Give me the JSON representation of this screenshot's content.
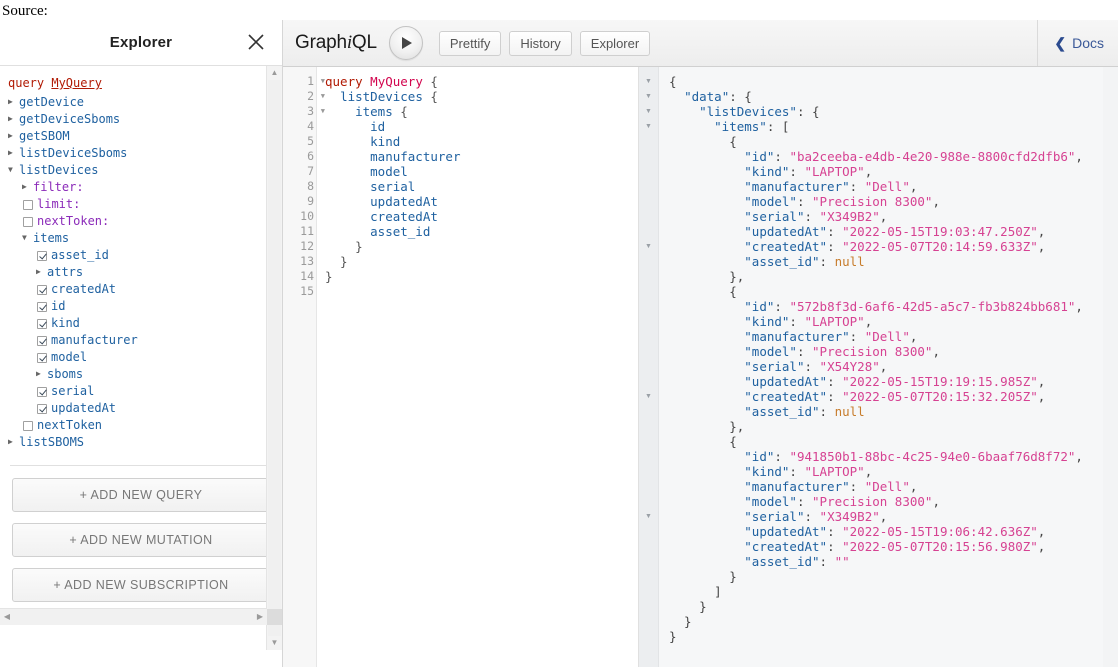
{
  "page": {
    "source_label": "Source:"
  },
  "explorer": {
    "title": "Explorer",
    "close_icon": "close-icon",
    "query_keyword": "query",
    "query_name": "MyQuery",
    "tree": [
      {
        "indent": 1,
        "control": "arrow-closed",
        "label": "getDevice",
        "style": "field"
      },
      {
        "indent": 1,
        "control": "arrow-closed",
        "label": "getDeviceSboms",
        "style": "field"
      },
      {
        "indent": 1,
        "control": "arrow-closed",
        "label": "getSBOM",
        "style": "field"
      },
      {
        "indent": 1,
        "control": "arrow-closed",
        "label": "listDeviceSboms",
        "style": "field"
      },
      {
        "indent": 1,
        "control": "arrow-open",
        "label": "listDevices",
        "style": "field"
      },
      {
        "indent": 2,
        "control": "arrow-closed",
        "label": "filter:",
        "style": "arg"
      },
      {
        "indent": 2,
        "control": "checkbox-off",
        "label": "limit:",
        "style": "arg"
      },
      {
        "indent": 2,
        "control": "checkbox-off",
        "label": "nextToken:",
        "style": "arg"
      },
      {
        "indent": 2,
        "control": "arrow-open",
        "label": "items",
        "style": "field"
      },
      {
        "indent": 3,
        "control": "checkbox-on",
        "label": "asset_id",
        "style": "field"
      },
      {
        "indent": 3,
        "control": "arrow-closed",
        "label": "attrs",
        "style": "field"
      },
      {
        "indent": 3,
        "control": "checkbox-on",
        "label": "createdAt",
        "style": "field"
      },
      {
        "indent": 3,
        "control": "checkbox-on",
        "label": "id",
        "style": "field"
      },
      {
        "indent": 3,
        "control": "checkbox-on",
        "label": "kind",
        "style": "field"
      },
      {
        "indent": 3,
        "control": "checkbox-on",
        "label": "manufacturer",
        "style": "field"
      },
      {
        "indent": 3,
        "control": "checkbox-on",
        "label": "model",
        "style": "field"
      },
      {
        "indent": 3,
        "control": "arrow-closed",
        "label": "sboms",
        "style": "field"
      },
      {
        "indent": 3,
        "control": "checkbox-on",
        "label": "serial",
        "style": "field"
      },
      {
        "indent": 3,
        "control": "checkbox-on",
        "label": "updatedAt",
        "style": "field"
      },
      {
        "indent": 2,
        "control": "checkbox-off",
        "label": "nextToken",
        "style": "field"
      },
      {
        "indent": 1,
        "control": "arrow-closed",
        "label": "listSBOMS",
        "style": "field"
      }
    ],
    "buttons": [
      {
        "label": "+ ADD NEW QUERY",
        "name": "add-new-query-button"
      },
      {
        "label": "+ ADD NEW MUTATION",
        "name": "add-new-mutation-button"
      },
      {
        "label": "+ ADD NEW SUBSCRIPTION",
        "name": "add-new-subscription-button"
      }
    ],
    "scrollbar": {
      "up_arrow": "▲",
      "down_arrow": "▼",
      "left_arrow": "◀",
      "right_arrow": "▶"
    }
  },
  "toolbar": {
    "logo_part1": "Graph",
    "logo_i": "i",
    "logo_part2": "QL",
    "execute_icon": "play-icon",
    "buttons": [
      {
        "label": "Prettify",
        "name": "prettify-button"
      },
      {
        "label": "History",
        "name": "history-button"
      },
      {
        "label": "Explorer",
        "name": "explorer-button"
      }
    ],
    "docs_label": "Docs",
    "docs_chevron": "‹"
  },
  "query_editor": {
    "line_numbers": [
      "1",
      "2",
      "3",
      "4",
      "5",
      "6",
      "7",
      "8",
      "9",
      "10",
      "11",
      "12",
      "13",
      "14",
      "15"
    ],
    "fold_lines": [
      1,
      2,
      3
    ],
    "fold_glyph": "▼",
    "lines": [
      [
        {
          "t": "kw",
          "v": "query"
        },
        {
          "t": "punc",
          "v": " "
        },
        {
          "t": "def",
          "v": "MyQuery"
        },
        {
          "t": "punc",
          "v": " {"
        }
      ],
      [
        {
          "t": "punc",
          "v": "  "
        },
        {
          "t": "field",
          "v": "listDevices"
        },
        {
          "t": "punc",
          "v": " {"
        }
      ],
      [
        {
          "t": "punc",
          "v": "    "
        },
        {
          "t": "field",
          "v": "items"
        },
        {
          "t": "punc",
          "v": " {"
        }
      ],
      [
        {
          "t": "punc",
          "v": "      "
        },
        {
          "t": "field",
          "v": "id"
        }
      ],
      [
        {
          "t": "punc",
          "v": "      "
        },
        {
          "t": "field",
          "v": "kind"
        }
      ],
      [
        {
          "t": "punc",
          "v": "      "
        },
        {
          "t": "field",
          "v": "manufacturer"
        }
      ],
      [
        {
          "t": "punc",
          "v": "      "
        },
        {
          "t": "field",
          "v": "model"
        }
      ],
      [
        {
          "t": "punc",
          "v": "      "
        },
        {
          "t": "field",
          "v": "serial"
        }
      ],
      [
        {
          "t": "punc",
          "v": "      "
        },
        {
          "t": "field",
          "v": "updatedAt"
        }
      ],
      [
        {
          "t": "punc",
          "v": "      "
        },
        {
          "t": "field",
          "v": "createdAt"
        }
      ],
      [
        {
          "t": "punc",
          "v": "      "
        },
        {
          "t": "field",
          "v": "asset_id"
        }
      ],
      [
        {
          "t": "punc",
          "v": "    }"
        }
      ],
      [
        {
          "t": "punc",
          "v": "  }"
        }
      ],
      [
        {
          "t": "punc",
          "v": "}"
        }
      ],
      []
    ]
  },
  "result_viewer": {
    "fold_rows": [
      1,
      2,
      3,
      4,
      12,
      22,
      30
    ],
    "fold_glyph": "▼",
    "lines": [
      [
        {
          "t": "punc",
          "v": "{"
        }
      ],
      [
        {
          "t": "punc",
          "v": "  "
        },
        {
          "t": "key",
          "v": "\"data\""
        },
        {
          "t": "punc",
          "v": ": {"
        }
      ],
      [
        {
          "t": "punc",
          "v": "    "
        },
        {
          "t": "key",
          "v": "\"listDevices\""
        },
        {
          "t": "punc",
          "v": ": {"
        }
      ],
      [
        {
          "t": "punc",
          "v": "      "
        },
        {
          "t": "key",
          "v": "\"items\""
        },
        {
          "t": "punc",
          "v": ": ["
        }
      ],
      [
        {
          "t": "punc",
          "v": "        {"
        }
      ],
      [
        {
          "t": "punc",
          "v": "          "
        },
        {
          "t": "key",
          "v": "\"id\""
        },
        {
          "t": "punc",
          "v": ": "
        },
        {
          "t": "str",
          "v": "\"ba2ceeba-e4db-4e20-988e-8800cfd2dfb6\""
        },
        {
          "t": "punc",
          "v": ","
        }
      ],
      [
        {
          "t": "punc",
          "v": "          "
        },
        {
          "t": "key",
          "v": "\"kind\""
        },
        {
          "t": "punc",
          "v": ": "
        },
        {
          "t": "str",
          "v": "\"LAPTOP\""
        },
        {
          "t": "punc",
          "v": ","
        }
      ],
      [
        {
          "t": "punc",
          "v": "          "
        },
        {
          "t": "key",
          "v": "\"manufacturer\""
        },
        {
          "t": "punc",
          "v": ": "
        },
        {
          "t": "str",
          "v": "\"Dell\""
        },
        {
          "t": "punc",
          "v": ","
        }
      ],
      [
        {
          "t": "punc",
          "v": "          "
        },
        {
          "t": "key",
          "v": "\"model\""
        },
        {
          "t": "punc",
          "v": ": "
        },
        {
          "t": "str",
          "v": "\"Precision 8300\""
        },
        {
          "t": "punc",
          "v": ","
        }
      ],
      [
        {
          "t": "punc",
          "v": "          "
        },
        {
          "t": "key",
          "v": "\"serial\""
        },
        {
          "t": "punc",
          "v": ": "
        },
        {
          "t": "str",
          "v": "\"X349B2\""
        },
        {
          "t": "punc",
          "v": ","
        }
      ],
      [
        {
          "t": "punc",
          "v": "          "
        },
        {
          "t": "key",
          "v": "\"updatedAt\""
        },
        {
          "t": "punc",
          "v": ": "
        },
        {
          "t": "str",
          "v": "\"2022-05-15T19:03:47.250Z\""
        },
        {
          "t": "punc",
          "v": ","
        }
      ],
      [
        {
          "t": "punc",
          "v": "          "
        },
        {
          "t": "key",
          "v": "\"createdAt\""
        },
        {
          "t": "punc",
          "v": ": "
        },
        {
          "t": "str",
          "v": "\"2022-05-07T20:14:59.633Z\""
        },
        {
          "t": "punc",
          "v": ","
        }
      ],
      [
        {
          "t": "punc",
          "v": "          "
        },
        {
          "t": "key",
          "v": "\"asset_id\""
        },
        {
          "t": "punc",
          "v": ": "
        },
        {
          "t": "null",
          "v": "null"
        }
      ],
      [
        {
          "t": "punc",
          "v": "        },"
        }
      ],
      [
        {
          "t": "punc",
          "v": "        {"
        }
      ],
      [
        {
          "t": "punc",
          "v": "          "
        },
        {
          "t": "key",
          "v": "\"id\""
        },
        {
          "t": "punc",
          "v": ": "
        },
        {
          "t": "str",
          "v": "\"572b8f3d-6af6-42d5-a5c7-fb3b824bb681\""
        },
        {
          "t": "punc",
          "v": ","
        }
      ],
      [
        {
          "t": "punc",
          "v": "          "
        },
        {
          "t": "key",
          "v": "\"kind\""
        },
        {
          "t": "punc",
          "v": ": "
        },
        {
          "t": "str",
          "v": "\"LAPTOP\""
        },
        {
          "t": "punc",
          "v": ","
        }
      ],
      [
        {
          "t": "punc",
          "v": "          "
        },
        {
          "t": "key",
          "v": "\"manufacturer\""
        },
        {
          "t": "punc",
          "v": ": "
        },
        {
          "t": "str",
          "v": "\"Dell\""
        },
        {
          "t": "punc",
          "v": ","
        }
      ],
      [
        {
          "t": "punc",
          "v": "          "
        },
        {
          "t": "key",
          "v": "\"model\""
        },
        {
          "t": "punc",
          "v": ": "
        },
        {
          "t": "str",
          "v": "\"Precision 8300\""
        },
        {
          "t": "punc",
          "v": ","
        }
      ],
      [
        {
          "t": "punc",
          "v": "          "
        },
        {
          "t": "key",
          "v": "\"serial\""
        },
        {
          "t": "punc",
          "v": ": "
        },
        {
          "t": "str",
          "v": "\"X54Y28\""
        },
        {
          "t": "punc",
          "v": ","
        }
      ],
      [
        {
          "t": "punc",
          "v": "          "
        },
        {
          "t": "key",
          "v": "\"updatedAt\""
        },
        {
          "t": "punc",
          "v": ": "
        },
        {
          "t": "str",
          "v": "\"2022-05-15T19:19:15.985Z\""
        },
        {
          "t": "punc",
          "v": ","
        }
      ],
      [
        {
          "t": "punc",
          "v": "          "
        },
        {
          "t": "key",
          "v": "\"createdAt\""
        },
        {
          "t": "punc",
          "v": ": "
        },
        {
          "t": "str",
          "v": "\"2022-05-07T20:15:32.205Z\""
        },
        {
          "t": "punc",
          "v": ","
        }
      ],
      [
        {
          "t": "punc",
          "v": "          "
        },
        {
          "t": "key",
          "v": "\"asset_id\""
        },
        {
          "t": "punc",
          "v": ": "
        },
        {
          "t": "null",
          "v": "null"
        }
      ],
      [
        {
          "t": "punc",
          "v": "        },"
        }
      ],
      [
        {
          "t": "punc",
          "v": "        {"
        }
      ],
      [
        {
          "t": "punc",
          "v": "          "
        },
        {
          "t": "key",
          "v": "\"id\""
        },
        {
          "t": "punc",
          "v": ": "
        },
        {
          "t": "str",
          "v": "\"941850b1-88bc-4c25-94e0-6baaf76d8f72\""
        },
        {
          "t": "punc",
          "v": ","
        }
      ],
      [
        {
          "t": "punc",
          "v": "          "
        },
        {
          "t": "key",
          "v": "\"kind\""
        },
        {
          "t": "punc",
          "v": ": "
        },
        {
          "t": "str",
          "v": "\"LAPTOP\""
        },
        {
          "t": "punc",
          "v": ","
        }
      ],
      [
        {
          "t": "punc",
          "v": "          "
        },
        {
          "t": "key",
          "v": "\"manufacturer\""
        },
        {
          "t": "punc",
          "v": ": "
        },
        {
          "t": "str",
          "v": "\"Dell\""
        },
        {
          "t": "punc",
          "v": ","
        }
      ],
      [
        {
          "t": "punc",
          "v": "          "
        },
        {
          "t": "key",
          "v": "\"model\""
        },
        {
          "t": "punc",
          "v": ": "
        },
        {
          "t": "str",
          "v": "\"Precision 8300\""
        },
        {
          "t": "punc",
          "v": ","
        }
      ],
      [
        {
          "t": "punc",
          "v": "          "
        },
        {
          "t": "key",
          "v": "\"serial\""
        },
        {
          "t": "punc",
          "v": ": "
        },
        {
          "t": "str",
          "v": "\"X349B2\""
        },
        {
          "t": "punc",
          "v": ","
        }
      ],
      [
        {
          "t": "punc",
          "v": "          "
        },
        {
          "t": "key",
          "v": "\"updatedAt\""
        },
        {
          "t": "punc",
          "v": ": "
        },
        {
          "t": "str",
          "v": "\"2022-05-15T19:06:42.636Z\""
        },
        {
          "t": "punc",
          "v": ","
        }
      ],
      [
        {
          "t": "punc",
          "v": "          "
        },
        {
          "t": "key",
          "v": "\"createdAt\""
        },
        {
          "t": "punc",
          "v": ": "
        },
        {
          "t": "str",
          "v": "\"2022-05-07T20:15:56.980Z\""
        },
        {
          "t": "punc",
          "v": ","
        }
      ],
      [
        {
          "t": "punc",
          "v": "          "
        },
        {
          "t": "key",
          "v": "\"asset_id\""
        },
        {
          "t": "punc",
          "v": ": "
        },
        {
          "t": "str",
          "v": "\"\""
        }
      ],
      [
        {
          "t": "punc",
          "v": "        }"
        }
      ],
      [
        {
          "t": "punc",
          "v": "      ]"
        }
      ],
      [
        {
          "t": "punc",
          "v": "    }"
        }
      ],
      [
        {
          "t": "punc",
          "v": "  }"
        }
      ],
      [
        {
          "t": "punc",
          "v": "}"
        }
      ]
    ]
  },
  "colors": {
    "keyword": "#b11a04",
    "definition": "#d2054e",
    "field": "#1f61a0",
    "argument": "#8b2bb9",
    "string": "#d64292",
    "null": "#c77c2b",
    "docs_link": "#3b5998",
    "result_bg": "#f6f7f8"
  }
}
